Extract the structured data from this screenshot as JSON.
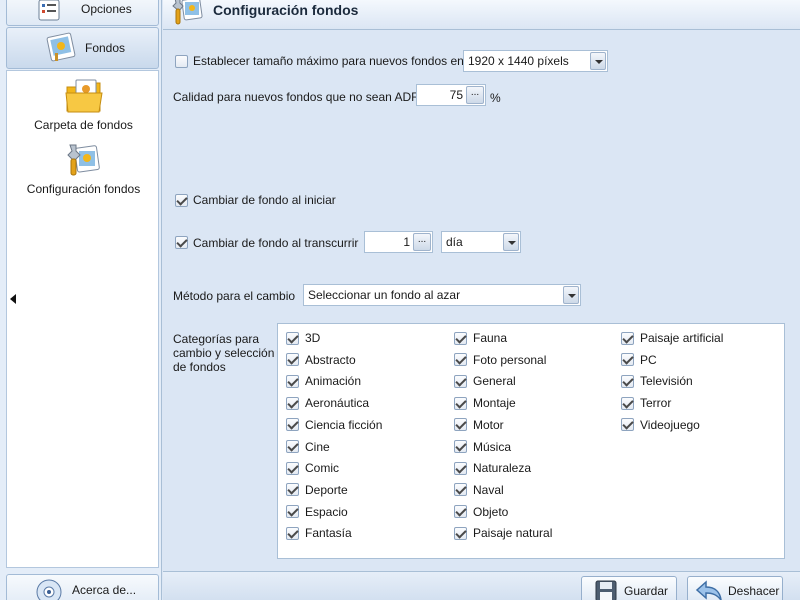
{
  "sidebar": {
    "opciones_label": "Opciones",
    "fondos_label": "Fondos",
    "sub_items": [
      "Carpeta de fondos",
      "Configuración fondos"
    ],
    "acerca_label": "Acerca de..."
  },
  "header": {
    "title": "Configuración fondos"
  },
  "settings": {
    "max_size_label": "Establecer tamaño máximo para nuevos fondos en",
    "max_size_checked": false,
    "max_size_value": "1920 x 1440 píxels",
    "quality_label": "Calidad para nuevos fondos que no sean ADF",
    "quality_value": "75",
    "quality_unit": "%",
    "change_on_start_label": "Cambiar de fondo al iniciar",
    "change_on_start_checked": true,
    "change_interval_label": "Cambiar de fondo al transcurrir",
    "change_interval_checked": true,
    "interval_value": "1",
    "interval_unit": "día",
    "method_label": "Método para el cambio",
    "method_value": "Seleccionar un fondo al azar",
    "dots": "..."
  },
  "categories": {
    "label_lines": [
      "Categorías para",
      "cambio y selección",
      "de fondos"
    ],
    "columns": [
      [
        "3D",
        "Abstracto",
        "Animación",
        "Aeronáutica",
        "Ciencia ficción",
        "Cine",
        "Comic",
        "Deporte",
        "Espacio",
        "Fantasía"
      ],
      [
        "Fauna",
        "Foto personal",
        "General",
        "Montaje",
        "Motor",
        "Música",
        "Naturaleza",
        "Naval",
        "Objeto",
        "Paisaje natural"
      ],
      [
        "Paisaje artificial",
        "PC",
        "Televisión",
        "Terror",
        "Videojuego"
      ]
    ]
  },
  "footer": {
    "save_label": "Guardar",
    "undo_label": "Deshacer"
  },
  "colors": {
    "panel": "#dbe6f4",
    "border": "#a9bfd6",
    "accent": "#f2b61a"
  },
  "icons": {
    "opciones": "options-list-icon",
    "fondos": "wallpaper-icon",
    "carpeta": "folder-wallpaper-icon",
    "configuracion": "wallpaper-settings-icon",
    "acerca": "about-disc-icon",
    "guardar": "save-disk-icon",
    "deshacer": "undo-arrow-icon"
  }
}
